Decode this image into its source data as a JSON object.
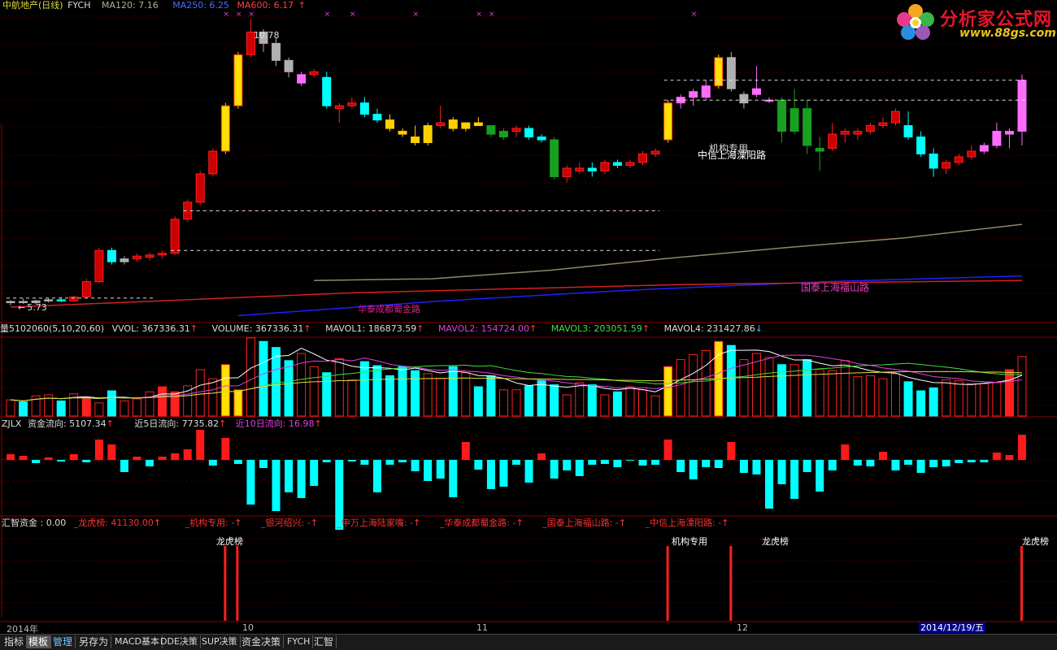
{
  "colors": {
    "up": "#ff2020",
    "down": "#00ffff",
    "grid": "#7a0000",
    "ma120": "#8a8a6a",
    "ma250": "#2020ff",
    "ma600": "#d42020"
  },
  "price_header": {
    "name": "中航地产(日线)",
    "formula": "FYCH",
    "ma120": "MA120: 7.16",
    "ma250": "MA250: 6.25",
    "ma600": "MA600: 6.17"
  },
  "price_annotations": {
    "high": "10.78",
    "low": "5.73",
    "seat1": "华泰成都蜀金路",
    "seat2": "国泰上海福山路",
    "seat3": "中信上海溧阳路",
    "seat4": "机构专用"
  },
  "vol_header": {
    "title": "量5102060(5,10,20,60)",
    "vvol": "VVOL: 367336.31",
    "volume": "VOLUME: 367336.31",
    "mavol1": "MAVOL1: 186873.59",
    "mavol2": "MAVOL2: 154724.00",
    "mavol3": "MAVOL3: 203051.59",
    "mavol4": "MAVOL4: 231427.86"
  },
  "flow_header": {
    "title": "ZJLX",
    "flow": "资金流向: 5107.34",
    "flow5": "近5日流向: 7735.82",
    "flow10": "近10日流向: 16.98"
  },
  "seat_header": {
    "title": "汇智资金 : 0.00",
    "lhb": "_龙虎榜: 41130.00",
    "jg": "_机构专用: -",
    "yh": "_银河绍兴: -",
    "sw": "_申万上海陆家嘴: -",
    "ht": "_华泰成都蜀金路: -",
    "gt": "_国泰上海福山路: -",
    "zx": "_中信上海溧阳路: -"
  },
  "seat_labels": {
    "m1": "龙虎榜",
    "m2": "机构专用",
    "m3": "龙虎榜",
    "m4": "龙虎榜"
  },
  "date_axis": {
    "year": "2014年",
    "m10": "10",
    "m11": "11",
    "m12": "12",
    "current": "2014/12/19/五"
  },
  "tabs": [
    "指标",
    "模板",
    "管理",
    "另存为",
    "MACD基本",
    "DDE决策",
    "SUP决策",
    "资金决策",
    "FYCH",
    "汇智"
  ],
  "logo": {
    "title": "分析家公式网",
    "url": "www.88gs.com"
  },
  "chart_data": {
    "type": "candlestick",
    "ohlc": [
      [
        5.78,
        5.82,
        5.73,
        5.8
      ],
      [
        5.8,
        5.85,
        5.76,
        5.78
      ],
      [
        5.78,
        5.83,
        5.75,
        5.81
      ],
      [
        5.81,
        5.86,
        5.78,
        5.83
      ],
      [
        5.83,
        5.88,
        5.79,
        5.81
      ],
      [
        5.81,
        5.9,
        5.8,
        5.88
      ],
      [
        5.88,
        6.2,
        5.86,
        6.15
      ],
      [
        6.15,
        6.75,
        6.12,
        6.7
      ],
      [
        6.7,
        6.75,
        6.45,
        6.5
      ],
      [
        6.5,
        6.6,
        6.45,
        6.55
      ],
      [
        6.55,
        6.65,
        6.5,
        6.6
      ],
      [
        6.58,
        6.66,
        6.52,
        6.62
      ],
      [
        6.62,
        6.7,
        6.55,
        6.65
      ],
      [
        6.65,
        7.3,
        6.62,
        7.25
      ],
      [
        7.25,
        7.6,
        7.2,
        7.55
      ],
      [
        7.55,
        8.1,
        7.5,
        8.05
      ],
      [
        8.05,
        8.5,
        8.0,
        8.45
      ],
      [
        8.45,
        9.3,
        8.4,
        9.25
      ],
      [
        9.25,
        10.2,
        9.2,
        10.15
      ],
      [
        10.15,
        10.78,
        10.1,
        10.55
      ],
      [
        10.55,
        10.6,
        10.2,
        10.35
      ],
      [
        10.35,
        10.45,
        9.95,
        10.05
      ],
      [
        10.05,
        10.1,
        9.75,
        9.85
      ],
      [
        9.65,
        9.85,
        9.6,
        9.8
      ],
      [
        9.8,
        9.9,
        9.75,
        9.85
      ],
      [
        9.75,
        9.85,
        9.2,
        9.25
      ],
      [
        9.2,
        9.3,
        8.95,
        9.25
      ],
      [
        9.25,
        9.4,
        9.2,
        9.3
      ],
      [
        9.3,
        9.4,
        9.05,
        9.1
      ],
      [
        9.1,
        9.2,
        8.95,
        9.0
      ],
      [
        9.0,
        9.1,
        8.8,
        8.85
      ],
      [
        8.8,
        8.85,
        8.7,
        8.75
      ],
      [
        8.7,
        8.9,
        8.55,
        8.6
      ],
      [
        8.6,
        8.95,
        8.55,
        8.9
      ],
      [
        8.9,
        9.25,
        8.85,
        8.95
      ],
      [
        9.0,
        9.05,
        8.8,
        8.85
      ],
      [
        8.85,
        8.95,
        8.8,
        8.95
      ],
      [
        8.95,
        9.05,
        8.9,
        8.9
      ],
      [
        8.9,
        8.9,
        8.7,
        8.75
      ],
      [
        8.7,
        8.85,
        8.65,
        8.8
      ],
      [
        8.8,
        8.9,
        8.7,
        8.85
      ],
      [
        8.85,
        8.9,
        8.65,
        8.7
      ],
      [
        8.7,
        8.75,
        8.6,
        8.65
      ],
      [
        8.65,
        8.7,
        7.95,
        8.0
      ],
      [
        8.0,
        8.2,
        7.9,
        8.15
      ],
      [
        8.1,
        8.25,
        8.05,
        8.15
      ],
      [
        8.15,
        8.25,
        8.0,
        8.1
      ],
      [
        8.1,
        8.3,
        8.05,
        8.25
      ],
      [
        8.25,
        8.3,
        8.15,
        8.2
      ],
      [
        8.2,
        8.3,
        8.15,
        8.25
      ],
      [
        8.25,
        8.45,
        8.2,
        8.4
      ],
      [
        8.4,
        8.5,
        8.35,
        8.45
      ],
      [
        8.65,
        9.35,
        8.6,
        9.3
      ],
      [
        9.3,
        9.45,
        9.2,
        9.4
      ],
      [
        9.4,
        9.55,
        9.25,
        9.5
      ],
      [
        9.4,
        9.7,
        9.35,
        9.6
      ],
      [
        9.6,
        10.15,
        9.55,
        10.1
      ],
      [
        10.1,
        10.2,
        9.5,
        9.55
      ],
      [
        9.3,
        9.5,
        9.2,
        9.45
      ],
      [
        9.45,
        9.95,
        9.4,
        9.55
      ],
      [
        9.35,
        9.4,
        9.3,
        9.35
      ],
      [
        9.35,
        9.4,
        8.6,
        8.8
      ],
      [
        8.8,
        9.55,
        8.75,
        9.2
      ],
      [
        9.2,
        9.35,
        8.4,
        8.55
      ],
      [
        8.45,
        8.7,
        8.1,
        8.5
      ],
      [
        8.5,
        8.95,
        8.45,
        8.75
      ],
      [
        8.75,
        8.85,
        8.6,
        8.8
      ],
      [
        8.75,
        8.85,
        8.65,
        8.8
      ],
      [
        8.8,
        8.95,
        8.75,
        8.9
      ],
      [
        8.9,
        9.05,
        8.85,
        8.95
      ],
      [
        8.95,
        9.2,
        8.9,
        9.15
      ],
      [
        8.9,
        9.15,
        8.65,
        8.7
      ],
      [
        8.7,
        8.8,
        8.35,
        8.4
      ],
      [
        8.4,
        8.5,
        8.0,
        8.15
      ],
      [
        8.15,
        8.3,
        8.05,
        8.25
      ],
      [
        8.25,
        8.4,
        8.2,
        8.35
      ],
      [
        8.35,
        8.55,
        8.3,
        8.45
      ],
      [
        8.45,
        8.6,
        8.4,
        8.55
      ],
      [
        8.55,
        8.95,
        8.5,
        8.8
      ],
      [
        8.75,
        8.85,
        8.5,
        8.8
      ],
      [
        8.8,
        9.8,
        8.55,
        9.7
      ]
    ],
    "ma120": [
      6.17,
      6.2,
      6.35,
      6.56,
      6.75,
      6.92,
      7.16
    ],
    "ma250": [
      5.55,
      5.8,
      6.0,
      6.15,
      6.25
    ],
    "ma600": [
      5.7,
      5.95,
      6.1,
      6.17
    ],
    "volume": [
      32,
      28,
      40,
      42,
      30,
      44,
      36,
      26,
      50,
      30,
      34,
      48,
      58,
      48,
      60,
      92,
      74,
      102,
      52,
      155,
      148,
      136,
      110,
      124,
      98,
      86,
      114,
      72,
      108,
      100,
      80,
      98,
      90,
      84,
      75,
      98,
      86,
      58,
      80,
      52,
      52,
      60,
      70,
      62,
      42,
      66,
      62,
      42,
      48,
      58,
      52,
      40,
      98,
      112,
      122,
      130,
      148,
      140,
      112,
      124,
      116,
      102,
      102,
      112,
      92,
      90,
      110,
      78,
      80,
      74,
      84,
      68,
      50,
      56,
      72,
      70,
      64,
      64,
      66,
      92,
      118
    ],
    "flow": [
      7,
      5,
      -4,
      3,
      -2,
      7,
      -3,
      25,
      19,
      -15,
      4,
      -8,
      4,
      8,
      13,
      37,
      -7,
      27,
      -5,
      -55,
      -10,
      -63,
      -40,
      -47,
      -32,
      -3,
      -86,
      -2,
      -6,
      -40,
      -6,
      -3,
      -14,
      -26,
      -23,
      -46,
      22,
      -12,
      -36,
      -33,
      -6,
      -28,
      8,
      -23,
      -13,
      -20,
      -6,
      -5,
      -9,
      -1,
      -7,
      -6,
      25,
      -15,
      -24,
      -9,
      -10,
      22,
      -16,
      -18,
      -60,
      -30,
      -48,
      -15,
      -39,
      -13,
      19,
      -7,
      -8,
      10,
      -13,
      -6,
      -16,
      -9,
      -8,
      -4,
      -3,
      -3,
      9,
      6,
      31
    ],
    "events": [
      {
        "label": "龙虎榜",
        "index": 17
      },
      {
        "label": "机构专用",
        "index": 52
      },
      {
        "label": "龙虎榜",
        "index": 57
      },
      {
        "label": "龙虎榜",
        "index": 80
      }
    ]
  }
}
